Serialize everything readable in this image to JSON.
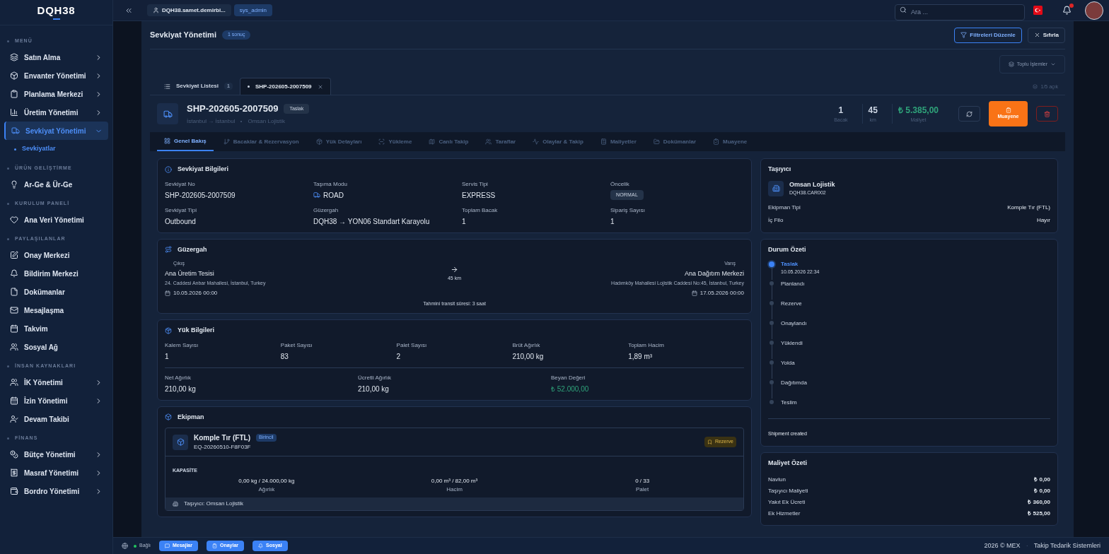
{
  "sidebar": {
    "logo": "DQH38",
    "sections": [
      {
        "title": "MENÜ",
        "items": [
          {
            "label": "Satın Alma",
            "expandable": true,
            "expanded": false,
            "selected": false
          },
          {
            "label": "Envanter Yönetimi",
            "expandable": true,
            "expanded": false,
            "selected": false
          },
          {
            "label": "Planlama Merkezi",
            "expandable": true,
            "expanded": false,
            "selected": false
          },
          {
            "label": "Üretim Yönetimi",
            "expandable": true,
            "expanded": false,
            "selected": false
          },
          {
            "label": "Sevkiyat Yönetimi",
            "expandable": true,
            "expanded": true,
            "selected": true,
            "children": [
              {
                "label": "Sevkiyatlar",
                "selected": true
              }
            ]
          }
        ]
      },
      {
        "title": "ÜRÜN GELİŞTİRME",
        "items": [
          {
            "label": "Ar-Ge & Ür-Ge",
            "expandable": false,
            "expanded": false,
            "selected": false
          }
        ]
      },
      {
        "title": "KURULUM PANELİ",
        "items": [
          {
            "label": "Ana Veri Yönetimi",
            "expandable": false,
            "expanded": false,
            "selected": false
          }
        ]
      },
      {
        "title": "PAYLAŞILANLAR",
        "items": [
          {
            "label": "Onay Merkezi",
            "expandable": false,
            "expanded": false,
            "selected": false
          },
          {
            "label": "Bildirim Merkezi",
            "expandable": false,
            "expanded": false,
            "selected": false
          },
          {
            "label": "Dokümanlar",
            "expandable": false,
            "expanded": false,
            "selected": false
          },
          {
            "label": "Mesajlaşma",
            "expandable": false,
            "expanded": false,
            "selected": false
          },
          {
            "label": "Takvim",
            "expandable": false,
            "expanded": false,
            "selected": false
          },
          {
            "label": "Sosyal Ağ",
            "expandable": false,
            "expanded": false,
            "selected": false
          }
        ]
      },
      {
        "title": "İNSAN KAYNAKLARI",
        "items": [
          {
            "label": "İK Yönetimi",
            "expandable": true,
            "expanded": false,
            "selected": false
          },
          {
            "label": "İzin Yönetimi",
            "expandable": true,
            "expanded": false,
            "selected": false
          },
          {
            "label": "Devam Takibi",
            "expandable": false,
            "expanded": false,
            "selected": false
          }
        ]
      },
      {
        "title": "FİNANS",
        "items": [
          {
            "label": "Bütçe Yönetimi",
            "expandable": true,
            "expanded": false,
            "selected": false
          },
          {
            "label": "Masraf Yönetimi",
            "expandable": true,
            "expanded": false,
            "selected": false
          },
          {
            "label": "Bordro Yönetimi",
            "expandable": true,
            "expanded": false,
            "selected": false
          }
        ]
      }
    ]
  },
  "topbar": {
    "user": "DQH38.samet.demirbi...",
    "role": "sys_admin",
    "search": {
      "placeholder": "Ara ..."
    },
    "notifications_unread": true
  },
  "page": {
    "title": "Sevkiyat Yönetimi",
    "count": "1 sonuç",
    "buttons": [
      "Filtreleri Düzenle",
      "Sıfırla"
    ],
    "bulk_actions": "Toplu İşlemler"
  },
  "tabs": [
    {
      "label": "Sevkiyat Listesi",
      "count": "1",
      "selected": false,
      "closable": false
    },
    {
      "label": "SHP-202605-2007509",
      "selected": true,
      "closable": true
    }
  ],
  "open_tabs": "1/5 açık",
  "shipment": {
    "id": "SHP-202605-2007509",
    "status": "Taslak",
    "route": "İstanbul → İstanbul",
    "carrier": "Omsan Lojistik",
    "stats": [
      {
        "value": "1",
        "label": "Bacak",
        "kind": "plain"
      },
      {
        "value": "45",
        "label": "km",
        "kind": "plain"
      },
      {
        "value": "₺ 5.385,00",
        "label": "Maliyet",
        "kind": "money"
      }
    ],
    "action": "Muayene"
  },
  "detail_tabs": [
    {
      "label": "Genel Bakış",
      "selected": true
    },
    {
      "label": "Bacaklar & Rezervasyon",
      "selected": false
    },
    {
      "label": "Yük Detayları",
      "selected": false
    },
    {
      "label": "Yükleme",
      "selected": false
    },
    {
      "label": "Canlı Takip",
      "selected": false
    },
    {
      "label": "Taraflar",
      "selected": false
    },
    {
      "label": "Olaylar & Takip",
      "selected": false
    },
    {
      "label": "Maliyetler",
      "selected": false
    },
    {
      "label": "Dokümanlar",
      "selected": false
    },
    {
      "label": "Muayene",
      "selected": false
    }
  ],
  "shipment_info": {
    "title": "Sevkiyat Bilgileri",
    "fields": [
      {
        "label": "Sevkiyat No",
        "value": "SHP-202605-2007509",
        "kind": "text"
      },
      {
        "label": "Taşıma Modu",
        "value": "ROAD",
        "kind": "mode"
      },
      {
        "label": "Servis Tipi",
        "value": "EXPRESS",
        "kind": "text"
      },
      {
        "label": "Öncelik",
        "value": "NORMAL",
        "kind": "badge"
      },
      {
        "label": "Sevkiyat Tipi",
        "value": "Outbound",
        "kind": "text"
      },
      {
        "label": "Güzergah",
        "value": "DQH38 → YON06 Standart Karayolu",
        "kind": "text"
      },
      {
        "label": "Toplam Bacak",
        "value": "1",
        "kind": "text"
      },
      {
        "label": "Sipariş Sayısı",
        "value": "1",
        "kind": "text"
      }
    ]
  },
  "route": {
    "title": "Güzergah",
    "origin": {
      "label": "Çıkış",
      "name": "Ana Üretim Tesisi",
      "address": "24. Caddesi Anbar Mahallesi, İstanbul, Turkey",
      "date": "10.05.2026 00:00"
    },
    "distance": "45 km",
    "destination": {
      "label": "Varış",
      "name": "Ana Dağıtım Merkezi",
      "address": "Hadımköy Mahallesi Lojistik Caddesi No:45, İstanbul, Turkey",
      "date": "17.05.2026 00:00"
    },
    "transit": "Tahmini transit süresi: 3 saat"
  },
  "cargo": {
    "title": "Yük Bilgileri",
    "rows": [
      [
        {
          "label": "Kalem Sayısı",
          "value": "1",
          "kind": "text"
        },
        {
          "label": "Paket Sayısı",
          "value": "83",
          "kind": "text"
        },
        {
          "label": "Palet Sayısı",
          "value": "2",
          "kind": "text"
        },
        {
          "label": "Brüt Ağırlık",
          "value": "210,00 kg",
          "kind": "text"
        },
        {
          "label": "Toplam Hacim",
          "value": "1,89 m³",
          "kind": "text"
        }
      ],
      [
        {
          "label": "Net Ağırlık",
          "value": "210,00 kg",
          "kind": "text"
        },
        {
          "label": "Ücretli Ağırlık",
          "value": "210,00 kg",
          "kind": "text"
        },
        {
          "label": "Beyan Değeri",
          "value": "₺ 52.000,00",
          "kind": "money"
        }
      ]
    ]
  },
  "equipment": {
    "title": "Ekipman",
    "name": "Komple Tır (FTL)",
    "tag": "Birincil",
    "code": "EQ-20260510-F8F03F",
    "status": "Rezerve",
    "capacity_title": "KAPASİTE",
    "capacity": [
      {
        "value": "0,00 kg / 24.000,00 kg",
        "label": "Ağırlık"
      },
      {
        "value": "0,00 m³ / 82,00 m³",
        "label": "Hacim"
      },
      {
        "value": "0 / 33",
        "label": "Palet"
      }
    ],
    "carrier": "Taşıyıcı: Omsan Lojistik"
  },
  "carrier_card": {
    "title": "Taşıyıcı",
    "name": "Omsan Lojistik",
    "code": "DQH38.CAR002",
    "rows": [
      {
        "label": "Ekipman Tipi",
        "value": "Komple Tır (FTL)"
      },
      {
        "label": "İç Filo",
        "value": "Hayır"
      }
    ]
  },
  "status_summary": {
    "title": "Durum Özeti",
    "steps": [
      {
        "label": "Taslak",
        "time": "10.05.2026 22:34",
        "active": true
      },
      {
        "label": "Planlandı",
        "active": false
      },
      {
        "label": "Rezerve",
        "active": false
      },
      {
        "label": "Onaylandı",
        "active": false
      },
      {
        "label": "Yüklendi",
        "active": false
      },
      {
        "label": "Yolda",
        "active": false
      },
      {
        "label": "Dağıtımda",
        "active": false
      },
      {
        "label": "Teslim",
        "active": false
      }
    ],
    "note": "Shipment created"
  },
  "cost_summary": {
    "title": "Maliyet Özeti",
    "rows": [
      {
        "label": "Navlun",
        "value": "₺ 0,00"
      },
      {
        "label": "Taşıyıcı Maliyeti",
        "value": "₺ 0,00"
      },
      {
        "label": "Yakıt Ek Ücreti",
        "value": "₺ 360,00"
      },
      {
        "label": "Ek Hizmetler",
        "value": "₺ 525,00"
      }
    ]
  },
  "status_bar": {
    "connection": "Bağlı",
    "connected": true,
    "buttons": [
      "Mesajlar",
      "Onaylar",
      "Sosyal"
    ],
    "copyright": "2026 © MEX",
    "separator": "·",
    "company": "Takip Tedarik Sistemleri"
  }
}
